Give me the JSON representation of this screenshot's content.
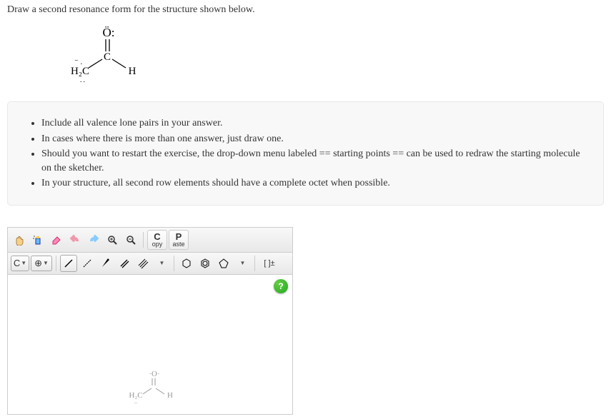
{
  "prompt": "Draw a second resonance form for the structure shown below.",
  "instructions": {
    "li1": "Include all valence lone pairs in your answer.",
    "li2": "In cases where there is more than one answer, just draw one.",
    "li3": "Should you want to restart the exercise, the drop-down menu labeled == starting points == can be used to redraw the starting molecule on the sketcher.",
    "li4": "In your structure, all second row elements should have a complete octet when possible."
  },
  "toolbar": {
    "copy_big": "C",
    "copy_small": "opy",
    "paste_big": "P",
    "paste_small": "aste",
    "carbon": "C",
    "charge": "[ ]±"
  },
  "help": "?",
  "canvas_mol": {
    "o_label": "O",
    "h2c": "H₂C",
    "h": "H"
  }
}
